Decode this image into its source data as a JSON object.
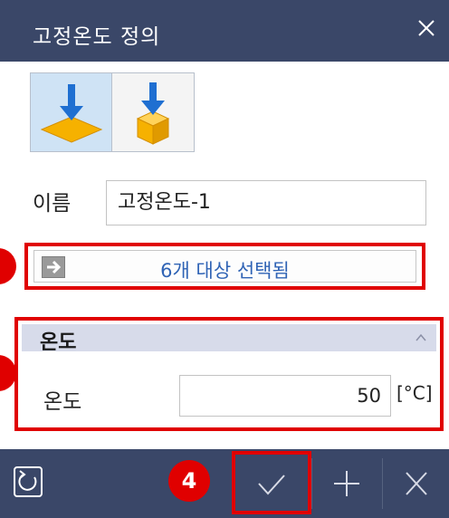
{
  "dialog": {
    "title": "고정온도 정의"
  },
  "mode_buttons": [
    {
      "icon": "face-target-icon",
      "active": true
    },
    {
      "icon": "solid-body-target-icon",
      "active": false
    }
  ],
  "name_field": {
    "label": "이름",
    "value": "고정온도-1"
  },
  "selection": {
    "text": "6개 대상 선택됨",
    "icon": "arrow-right-icon"
  },
  "temperature_section": {
    "header": "온도",
    "field_label": "온도",
    "value": "50",
    "unit": "[°C]"
  },
  "toolbar": {
    "reset_icon": "reset-icon",
    "ok_icon": "checkmark-icon",
    "add_icon": "plus-icon",
    "cancel_icon": "close-icon"
  },
  "callouts": {
    "ok_step": "4"
  },
  "colors": {
    "titlebar": "#3a4768",
    "highlight": "#e00000",
    "selection_text": "#2f63b5",
    "section_header": "#d7dbea"
  }
}
